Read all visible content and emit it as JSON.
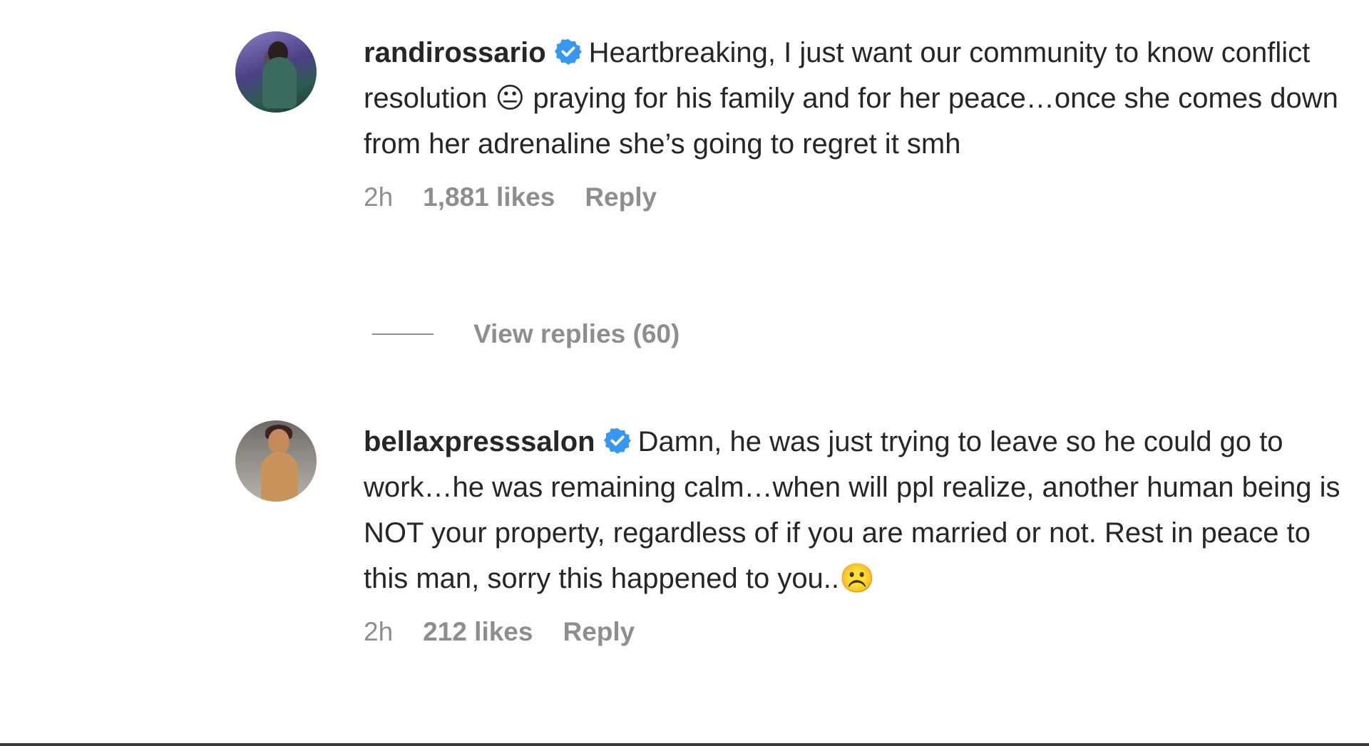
{
  "comments": [
    {
      "username": "randirossario",
      "verified": true,
      "text": "Heartbreaking, I just want our community to know conflict resolution 😐 praying for his family and for her peace…once she comes down from her adrenaline she’s going to regret it smh",
      "time": "2h",
      "likes": "1,881 likes",
      "reply_label": "Reply",
      "avatar_icon": "profile-photo"
    },
    {
      "username": "bellaxpresssalon",
      "verified": true,
      "text": "Damn, he was just trying to leave so he could go to work…he was remaining calm…when will ppl realize, another human being is NOT your property, regardless of if you are married or not. Rest in peace to this man, sorry this happened to you..☹️",
      "time": "2h",
      "likes": "212 likes",
      "reply_label": "Reply",
      "avatar_icon": "profile-photo"
    }
  ],
  "view_replies": "View replies (60)",
  "colors": {
    "text": "#262626",
    "secondary": "#8e8e8e",
    "verified": "#3897f0"
  }
}
